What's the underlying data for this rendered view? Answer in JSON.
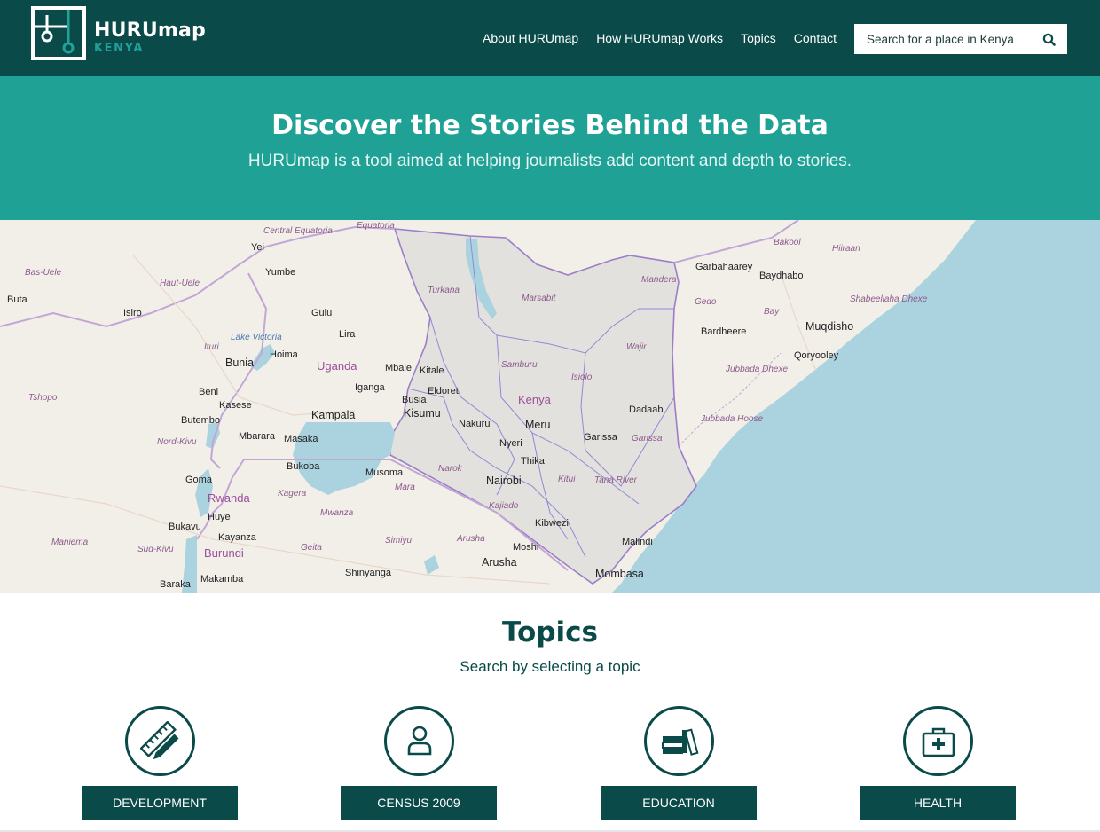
{
  "header": {
    "logo_title": "HURUmap",
    "logo_subtitle": "KENYA",
    "nav": [
      "About HURUmap",
      "How HURUmap Works",
      "Topics",
      "Contact"
    ],
    "search_placeholder": "Search for a place in Kenya"
  },
  "hero": {
    "title": "Discover the Stories Behind the Data",
    "subtitle": "HURUmap is a tool aimed at helping journalists add content and depth to stories."
  },
  "map": {
    "labels": [
      "Yei",
      "Yumbe",
      "Gulu",
      "Lira",
      "Hoima",
      "Uganda",
      "Mbale",
      "Kitale",
      "Eldoret",
      "Iganga",
      "Busia",
      "Kisumu",
      "Kampala",
      "Kasese",
      "Mbarara",
      "Masaka",
      "Bukoba",
      "Musoma",
      "Kenya",
      "Meru",
      "Nakuru",
      "Nyeri",
      "Thika",
      "Nairobi",
      "Garissa",
      "Dadaab",
      "Kitui",
      "Kibwezi",
      "Malindi",
      "Mombasa",
      "Moshi",
      "Arusha",
      "Shinyanga",
      "Goma",
      "Rwanda",
      "Bukavu",
      "Huye",
      "Kayanza",
      "Burundi",
      "Makamba",
      "Baraka",
      "Buta",
      "Isiro",
      "Bunia",
      "Beni",
      "Butembo",
      "Garbahaarey",
      "Baydhabo",
      "Bardheere",
      "Muqdisho",
      "Qoryooley"
    ],
    "regions": [
      "Bas-Uele",
      "Haut-Uele",
      "Ituri",
      "Tshopo",
      "Nord-Kivu",
      "Sud-Kivu",
      "Maniema",
      "Equatoria",
      "Central Equatoria",
      "Turkana",
      "Marsabit",
      "Mandera",
      "Wajir",
      "Samburu",
      "Isiolo",
      "Garissa",
      "Tana River",
      "Narok",
      "Kajiado",
      "Mara",
      "Mwanza",
      "Kagera",
      "Geita",
      "Simiyu",
      "Arusha",
      "Gedo",
      "Bay",
      "Bakool",
      "Hiiraan",
      "Jubbada Dhexe",
      "Jubbada Hoose",
      "Shabeellaha Dhexe",
      "Lake Victoria"
    ]
  },
  "topics": {
    "title": "Topics",
    "subtitle": "Search by selecting a topic",
    "items": [
      {
        "label": "DEVELOPMENT",
        "icon": "ruler-pencil-icon"
      },
      {
        "label": "CENSUS 2009",
        "icon": "person-icon"
      },
      {
        "label": "EDUCATION",
        "icon": "books-icon"
      },
      {
        "label": "HEALTH",
        "icon": "medical-kit-icon"
      }
    ]
  },
  "colors": {
    "brand_dark": "#0a4a48",
    "brand_teal": "#20a195",
    "ocean": "#aad3df",
    "land": "#f2efe9",
    "kenya_fill": "#e3e1dd",
    "border": "#9c7ec8"
  }
}
